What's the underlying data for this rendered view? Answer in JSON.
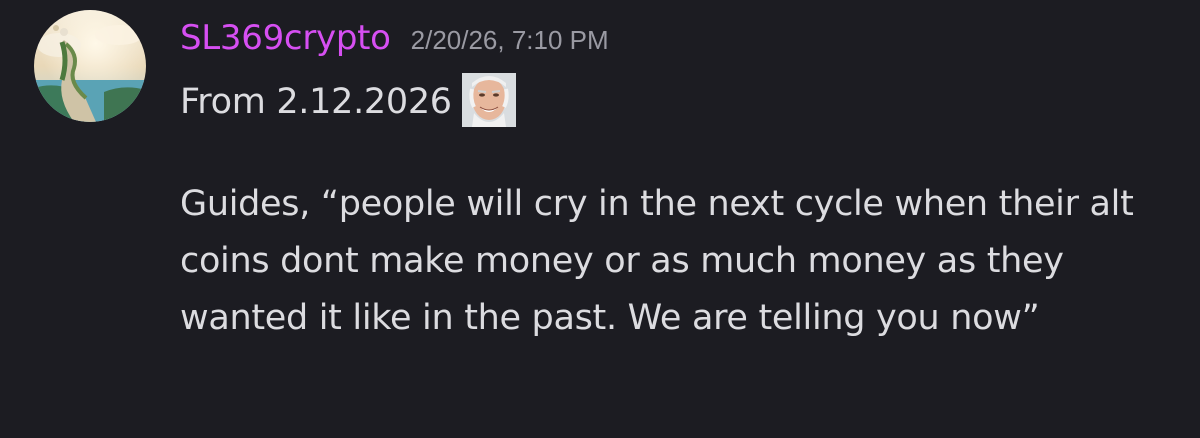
{
  "message": {
    "author": "SL369crypto",
    "timestamp": "2/20/26, 7:10 PM",
    "first_line": "From 2.12.2026",
    "emoji": "hide-the-pain-harold-emoji",
    "body": "Guides, “people will cry in the next cycle when their alt coins dont make money or as much money as they wanted it like in the past. We are telling you now”"
  },
  "colors": {
    "background": "#1c1c22",
    "username": "#d64ff2",
    "timestamp": "#9a9aa3",
    "text": "#dcdce0"
  },
  "avatar": {
    "icon": "stairway-to-heaven-avatar"
  }
}
